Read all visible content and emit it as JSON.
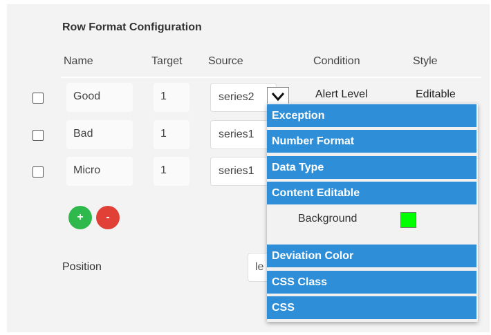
{
  "title": "Row Format Configuration",
  "columns": [
    "Name",
    "Target",
    "Source",
    "Condition",
    "Style"
  ],
  "rows": [
    {
      "name": "Good",
      "target": "1",
      "source": "series2",
      "condition": "Alert Level",
      "style": "Editable"
    },
    {
      "name": "Bad",
      "target": "1",
      "source": "series1"
    },
    {
      "name": "Micro",
      "target": "1",
      "source": "series1"
    }
  ],
  "buttons": {
    "add": "+",
    "remove": "-"
  },
  "position": {
    "label": "Position",
    "value": "le"
  },
  "dropdown": {
    "items": [
      "Exception",
      "Number Format",
      "Data Type",
      "Content Editable",
      "Deviation Color",
      "CSS Class",
      "CSS"
    ],
    "sub_label": "Background",
    "sub_color": "#00ff00"
  },
  "colors": {
    "accent": "#2e8fd8",
    "add": "#2fb84b",
    "remove": "#e04035"
  }
}
